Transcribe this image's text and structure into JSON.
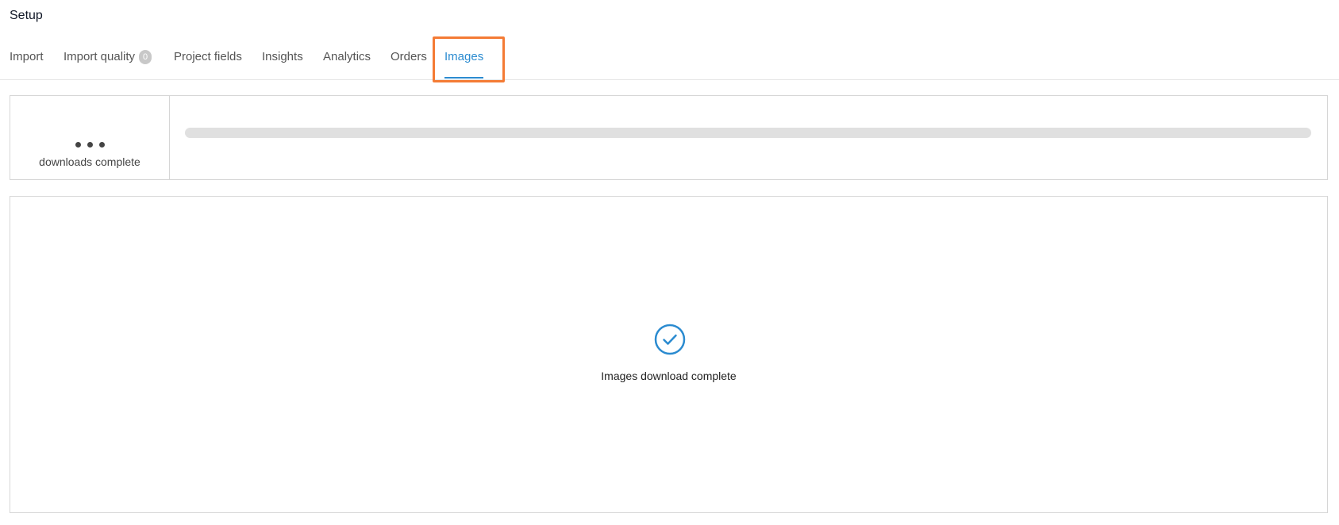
{
  "page": {
    "title": "Setup"
  },
  "tabs": [
    {
      "label": "Import",
      "badge": null,
      "active": false
    },
    {
      "label": "Import quality",
      "badge": "0",
      "active": false
    },
    {
      "label": "Project fields",
      "badge": null,
      "active": false
    },
    {
      "label": "Insights",
      "badge": null,
      "active": false
    },
    {
      "label": "Analytics",
      "badge": null,
      "active": false
    },
    {
      "label": "Orders",
      "badge": null,
      "active": false
    },
    {
      "label": "Images",
      "badge": null,
      "active": true
    }
  ],
  "stats": {
    "value_icon": "ellipsis-icon",
    "label": "downloads complete",
    "progress": 0
  },
  "status": {
    "icon": "check-circle-icon",
    "message": "Images download complete"
  },
  "colors": {
    "accent": "#2b8bd0",
    "highlight": "#f47b35",
    "track": "#e0e0e0",
    "badge": "#c8c8c8"
  }
}
